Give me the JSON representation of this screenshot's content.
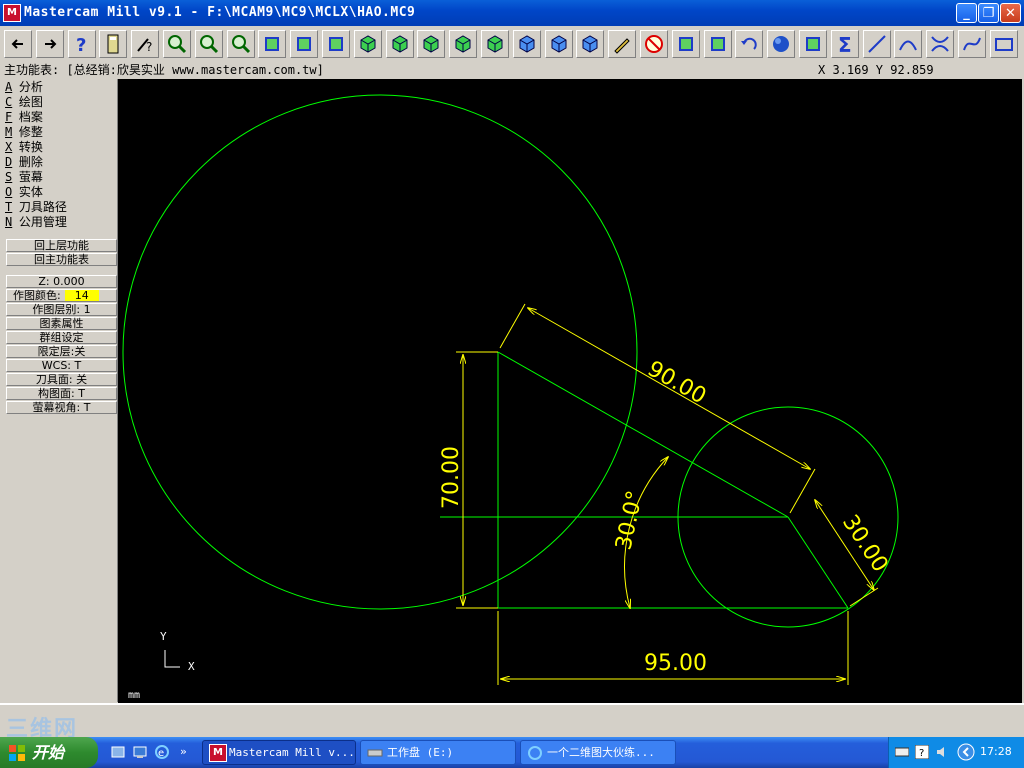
{
  "window": {
    "title": "Mastercam Mill v9.1 - F:\\MCAM9\\MC9\\MCLX\\HAO.MC9",
    "controls": {
      "minimize": "_",
      "restore": "❐",
      "close": "✕"
    }
  },
  "toolbar": {
    "buttons": [
      "back-arrow-icon",
      "forward-arrow-icon",
      "help-icon",
      "calculator-icon",
      "query-icon",
      "zoom-window-icon",
      "zoom-out-icon",
      "zoom-fit-icon",
      "pan-icon",
      "select-window-icon",
      "rotate-view-icon",
      "cube-top-icon",
      "cube-front-icon",
      "cube-side-icon",
      "cube-iso-icon",
      "cube-shaded-icon",
      "cube-wire-icon",
      "cube-blue-icon",
      "cube-outline-icon",
      "pencil-icon",
      "no-entry-icon",
      "transform-icon",
      "layers-icon",
      "undo-icon",
      "sphere-icon",
      "group-icon",
      "sigma-icon",
      "line-icon",
      "arc-icon",
      "trim-icon",
      "spline-icon",
      "rectangle-icon"
    ]
  },
  "status": {
    "menu_label": "主功能表: [总经销:欣昊实业 www.mastercam.com.tw]",
    "coords": "X 3.169   Y 92.859"
  },
  "menu": {
    "items": [
      {
        "key": "A",
        "label": "分析"
      },
      {
        "key": "C",
        "label": "绘图"
      },
      {
        "key": "F",
        "label": "档案"
      },
      {
        "key": "M",
        "label": "修整"
      },
      {
        "key": "X",
        "label": "转换"
      },
      {
        "key": "D",
        "label": "删除"
      },
      {
        "key": "S",
        "label": "萤幕"
      },
      {
        "key": "O",
        "label": "实体"
      },
      {
        "key": "T",
        "label": "刀具路径"
      },
      {
        "key": "N",
        "label": "公用管理"
      }
    ],
    "back_upper": "回上层功能",
    "back_main": "回主功能表",
    "z_label": "Z:   0.000",
    "color_label": "作图颜色:",
    "color_value": "14",
    "layer": "作图层别:  1",
    "attributes": "图素属性",
    "group": "群组设定",
    "limit_layer": "限定层:关",
    "wcs": "WCS:    T",
    "tool_plane": "刀具面: 关",
    "construct_plane": "构图面:  T",
    "screen_view": "萤幕视角:  T"
  },
  "drawing": {
    "dim_90": "90.00",
    "dim_70": "70.00",
    "dim_30": "30.00",
    "dim_95": "95.00",
    "angle": "30.0°",
    "axis_y": "Y",
    "axis_x": "X",
    "units": "mm",
    "colors": {
      "geometry": "#00ff00",
      "dimension": "#ffff00",
      "background": "#000000"
    }
  },
  "watermark": "三维网",
  "taskbar": {
    "start_label": "开始",
    "tasks": [
      {
        "label": "Mastercam Mill v...",
        "active": true
      },
      {
        "label": "工作盘 (E:)",
        "active": false
      },
      {
        "label": "一个二维图大伙练...",
        "active": false
      }
    ],
    "clock": "17:28"
  }
}
